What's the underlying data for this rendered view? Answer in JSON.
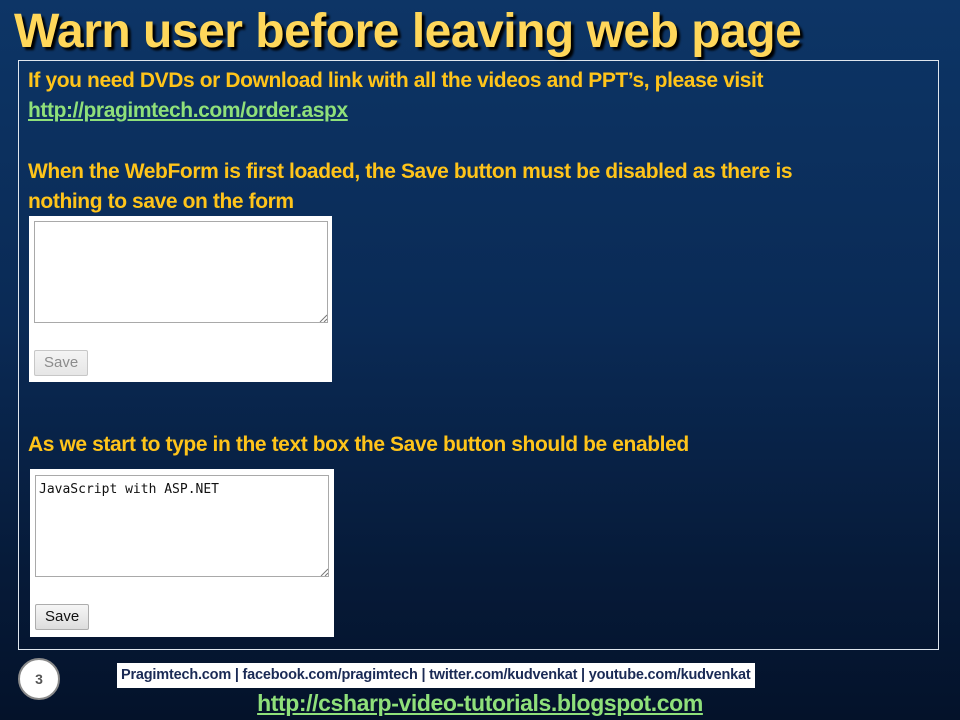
{
  "slide": {
    "title": "Warn user before leaving web page",
    "number": "3"
  },
  "content": {
    "intro_text": "If you need DVDs or Download link with all the videos and PPT’s, please visit",
    "order_link": "http://pragimtech.com/order.aspx",
    "point1_line1": "When the WebForm is first loaded, the Save button must be disabled as there is",
    "point1_line2": "nothing to save on the form",
    "point2": "As we start to type in the text box the Save button should be enabled"
  },
  "demo_before": {
    "textarea_value": "",
    "save_label": "Save",
    "save_enabled": false
  },
  "demo_after": {
    "textarea_value": "JavaScript with ASP.NET",
    "save_label": "Save",
    "save_enabled": true
  },
  "footer": {
    "links_text": "Pragimtech.com | facebook.com/pragimtech | twitter.com/kudvenkat | youtube.com/kudvenkat",
    "blog_url": "http://csharp-video-tutorials.blogspot.com"
  },
  "colors": {
    "title": "#ffd75a",
    "body_text": "#ffc41a",
    "link": "#8fe07a",
    "background_top": "#0d3566",
    "background_bottom": "#04122a"
  }
}
